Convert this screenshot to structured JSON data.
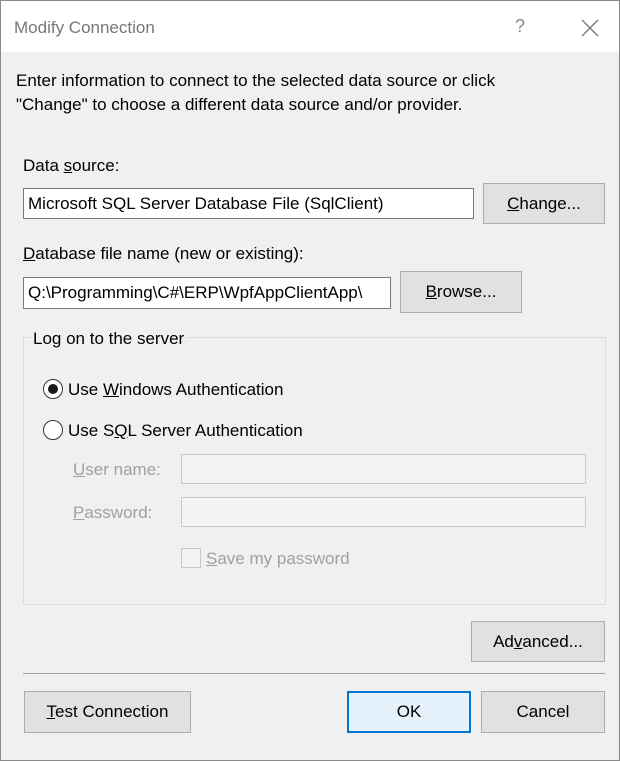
{
  "window": {
    "title": "Modify Connection",
    "help_glyph": "?",
    "close_icon": "close-icon"
  },
  "intro": {
    "line1": "Enter information to connect to the selected data source or click",
    "line2": "\"Change\" to choose a different data source and/or provider."
  },
  "data_source": {
    "label": "Data source:",
    "value": "Microsoft SQL Server Database File (SqlClient)",
    "change_button": "Change..."
  },
  "database_file": {
    "label": "Database file name (new or existing):",
    "value": "Q:\\Programming\\C#\\ERP\\WpfAppClientApp\\",
    "browse_button": "Browse..."
  },
  "logon": {
    "group_title": "Log on to the server",
    "windows_auth_label": "Use Windows Authentication",
    "sql_auth_label": "Use SQL Server Authentication",
    "selected": "windows",
    "user_name_label": "User name:",
    "user_name_value": "",
    "password_label": "Password:",
    "password_value": "",
    "save_password_label": "Save my password",
    "save_password_checked": false
  },
  "buttons": {
    "advanced": "Advanced...",
    "test_connection": "Test Connection",
    "ok": "OK",
    "cancel": "Cancel"
  },
  "colors": {
    "accent": "#0078d7",
    "dialog_bg": "#f0f0f0"
  }
}
